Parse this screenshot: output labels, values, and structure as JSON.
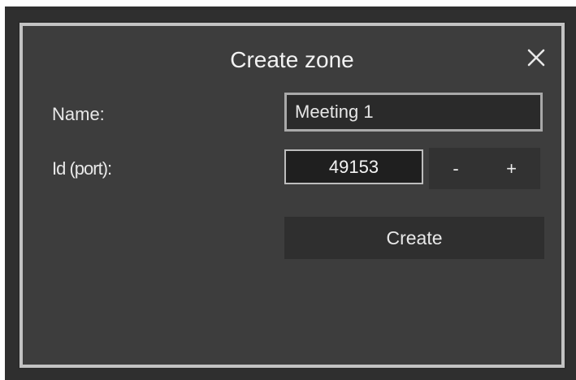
{
  "dialog": {
    "title": "Create zone",
    "close_icon": "close-icon"
  },
  "form": {
    "name_label": "Name:",
    "name_value": "Meeting 1",
    "port_label": "Id (port):",
    "port_value": "49153",
    "decrement_label": "-",
    "increment_label": "+",
    "create_label": "Create"
  },
  "colors": {
    "background": "#2f2f2f",
    "panel": "#3d3d3d",
    "border": "#c3c3c3",
    "text": "#e8e8e8"
  }
}
